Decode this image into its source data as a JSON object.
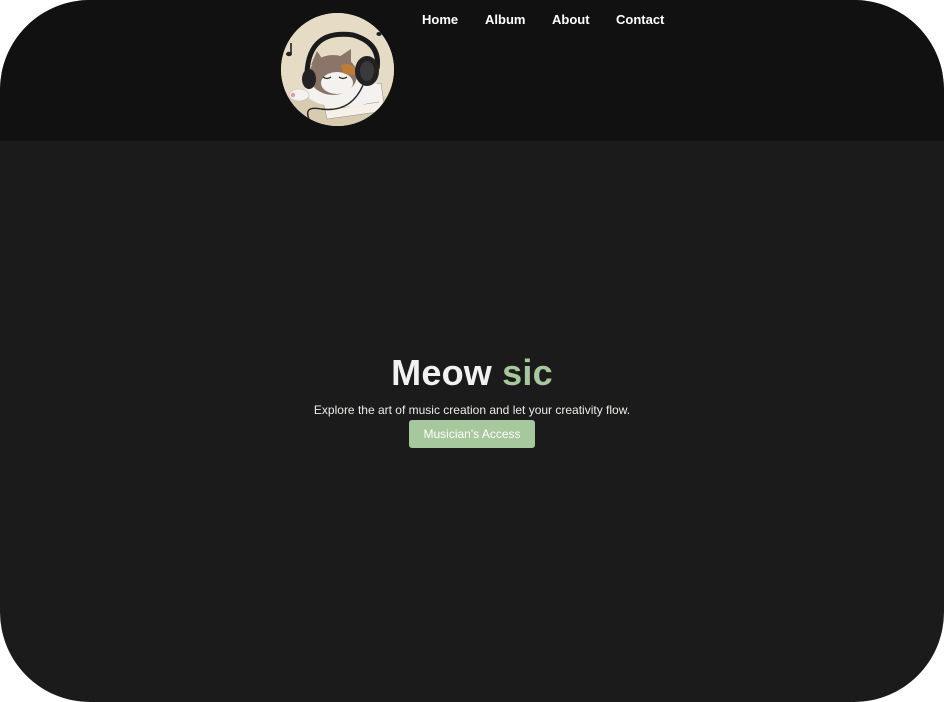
{
  "brand": {
    "logo_icon": "cat-with-headphones-logo"
  },
  "nav": {
    "items": [
      {
        "label": "Home"
      },
      {
        "label": "Album"
      },
      {
        "label": "About"
      },
      {
        "label": "Contact"
      }
    ]
  },
  "hero": {
    "title_main": "Meow",
    "title_accent": "sic",
    "subtitle": "Explore the art of music creation and let your creativity flow.",
    "cta_label": "Musician's Access"
  },
  "colors": {
    "header_bg": "#111111",
    "page_bg": "#1b1b1b",
    "accent": "#a7c79c",
    "text": "#f2f2f2"
  }
}
